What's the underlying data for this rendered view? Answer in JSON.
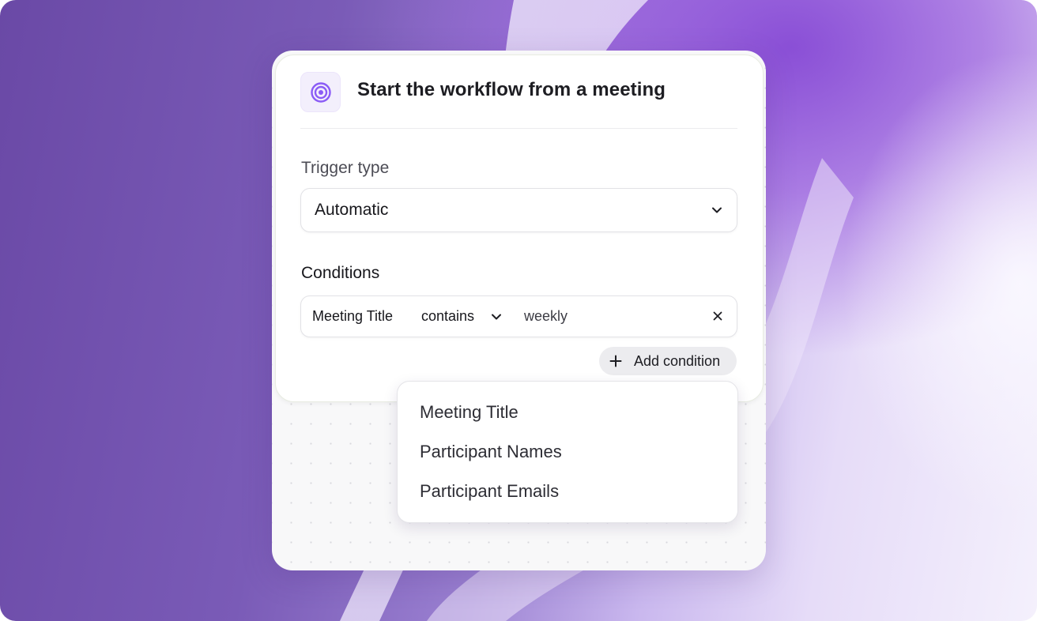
{
  "header": {
    "icon": "target-icon",
    "title": "Start the workflow from a meeting",
    "accent_color": "#8b5cf6"
  },
  "trigger": {
    "label": "Trigger type",
    "value": "Automatic",
    "icon": "chevron-down-icon"
  },
  "conditions": {
    "label": "Conditions",
    "items": [
      {
        "field": "Meeting Title",
        "operator": "contains",
        "value": "weekly",
        "remove_icon": "close-icon"
      }
    ],
    "add_label": "Add condition",
    "add_icon": "plus-icon"
  },
  "field_menu": {
    "options": [
      "Meeting Title",
      "Participant Names",
      "Participant Emails"
    ]
  }
}
